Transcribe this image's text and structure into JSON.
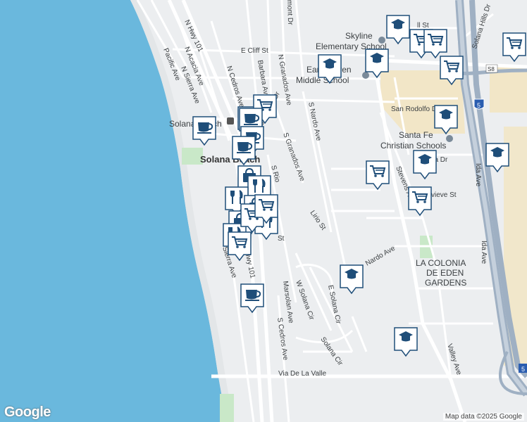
{
  "map": {
    "attribution": "Map data ©2025 Google",
    "logo": "Google",
    "colors": {
      "water": "#6ab8dd",
      "land": "#eceef0",
      "road": "#ffffff",
      "highway": "#a9b6c6",
      "park": "#c9e8c8",
      "school_area": "#f2e6c7",
      "marker": "#1f4e79"
    }
  },
  "labels": {
    "roads": [
      {
        "id": "n-hwy-101",
        "text": "N Hwy 101"
      },
      {
        "id": "n-acacia-ave",
        "text": "N Acacia Ave"
      },
      {
        "id": "n-sierra-ave",
        "text": "N Sierra Ave"
      },
      {
        "id": "pacific-ave",
        "text": "Pacific Ave"
      },
      {
        "id": "n-cedros-ave",
        "text": "N Cedros Ave"
      },
      {
        "id": "barbara-ave",
        "text": "Barbara Ave"
      },
      {
        "id": "n-granados-ave",
        "text": "N Granados Ave"
      },
      {
        "id": "santa-fe-dr",
        "text": "Santa Fe Dr"
      },
      {
        "id": "s-granados-ave",
        "text": "S Granados Ave"
      },
      {
        "id": "s-nardo-ave",
        "text": "S Nardo Ave"
      },
      {
        "id": "e-cliff-st",
        "text": "E Cliff St"
      },
      {
        "id": "lirio-st",
        "text": "Lirio St"
      },
      {
        "id": "san-rodolfo-dr",
        "text": "San Rodolfo Dr"
      },
      {
        "id": "stevens-ave",
        "text": "Stevens Ave"
      },
      {
        "id": "valley-ave",
        "text": "Valley Ave"
      },
      {
        "id": "ida-ave",
        "text": "Ida Ave"
      },
      {
        "id": "solana-hills-dr",
        "text": "Solana Hills Dr"
      },
      {
        "id": "marsolan-ave",
        "text": "Marsolan Ave"
      },
      {
        "id": "s-cedros-ave",
        "text": "S Cedros Ave"
      },
      {
        "id": "w-solana-cir",
        "text": "W Solana Cir"
      },
      {
        "id": "e-solana-cir",
        "text": "E Solana Cir"
      },
      {
        "id": "solana-cir",
        "text": "Solana Cir"
      },
      {
        "id": "via-de-la-valle",
        "text": "Via De La Valle"
      },
      {
        "id": "s-sierra-ave",
        "text": "Sierra Ave"
      },
      {
        "id": "s-hwy-101",
        "text": "Hwy 101"
      },
      {
        "id": "nardo-ave",
        "text": "Nardo Ave"
      },
      {
        "id": "genevieve-st",
        "text": "vieve St"
      },
      {
        "id": "acacia-dr",
        "text": "Acacia Dr"
      },
      {
        "id": "bel-st",
        "text": "ll St"
      },
      {
        "id": "s-rios",
        "text": "S Rio"
      },
      {
        "id": "amont-dr",
        "text": "mont Dr"
      },
      {
        "id": "s-st",
        "text": "St"
      }
    ],
    "places": [
      {
        "id": "skyline-elementary",
        "text": "Skyline"
      },
      {
        "id": "skyline-elementary-2",
        "text": "Elementary School"
      },
      {
        "id": "earl-warren",
        "text": "Earl Warren"
      },
      {
        "id": "earl-warren-2",
        "text": "Middle School"
      },
      {
        "id": "santa-fe-christian",
        "text": "Santa Fe"
      },
      {
        "id": "santa-fe-christian-2",
        "text": "Christian Schools"
      },
      {
        "id": "solana-beach",
        "text": "Solana Beach"
      },
      {
        "id": "solana-beach-2",
        "text": "Solana Beach"
      }
    ],
    "areas": [
      {
        "id": "la-colonia-1",
        "text": "LA COLONIA"
      },
      {
        "id": "la-colonia-2",
        "text": "DE EDEN"
      },
      {
        "id": "la-colonia-3",
        "text": "GARDENS"
      }
    ],
    "shields": [
      {
        "id": "i5-shield",
        "text": "5"
      },
      {
        "id": "i5-shield-2",
        "text": "5"
      },
      {
        "id": "s8-shield",
        "text": "S8"
      }
    ]
  },
  "markers": [
    {
      "type": "school",
      "icon": "graduation-cap-icon"
    },
    {
      "type": "grocery",
      "icon": "shopping-cart-icon"
    },
    {
      "type": "grocery",
      "icon": "shopping-cart-icon"
    },
    {
      "type": "school",
      "icon": "graduation-cap-icon"
    },
    {
      "type": "school",
      "icon": "graduation-cap-icon"
    },
    {
      "type": "grocery",
      "icon": "shopping-cart-icon"
    },
    {
      "type": "grocery",
      "icon": "shopping-cart-icon"
    },
    {
      "type": "school",
      "icon": "graduation-cap-icon"
    },
    {
      "type": "school",
      "icon": "graduation-cap-icon"
    },
    {
      "type": "school",
      "icon": "graduation-cap-icon"
    },
    {
      "type": "grocery",
      "icon": "shopping-cart-icon"
    },
    {
      "type": "grocery",
      "icon": "shopping-cart-icon"
    },
    {
      "type": "cafe",
      "icon": "coffee-cup-icon"
    },
    {
      "type": "cafe",
      "icon": "coffee-cup-icon"
    },
    {
      "type": "grocery",
      "icon": "shopping-cart-icon"
    },
    {
      "type": "cafe",
      "icon": "coffee-cup-icon"
    },
    {
      "type": "cafe",
      "icon": "coffee-cup-icon"
    },
    {
      "type": "cafe",
      "icon": "coffee-cup-icon"
    },
    {
      "type": "shopping",
      "icon": "shopping-bag-icon"
    },
    {
      "type": "restaurant",
      "icon": "fork-knife-icon"
    },
    {
      "type": "restaurant",
      "icon": "fork-knife-icon"
    },
    {
      "type": "shopping",
      "icon": "shopping-bag-icon"
    },
    {
      "type": "restaurant",
      "icon": "fork-knife-icon"
    },
    {
      "type": "shopping",
      "icon": "shopping-bag-icon"
    },
    {
      "type": "restaurant",
      "icon": "fork-knife-icon"
    },
    {
      "type": "grocery",
      "icon": "shopping-cart-icon"
    },
    {
      "type": "grocery",
      "icon": "shopping-cart-icon"
    },
    {
      "type": "grocery",
      "icon": "shopping-cart-icon"
    },
    {
      "type": "cafe",
      "icon": "coffee-cup-icon"
    },
    {
      "type": "school",
      "icon": "graduation-cap-icon"
    },
    {
      "type": "school",
      "icon": "graduation-cap-icon"
    }
  ]
}
